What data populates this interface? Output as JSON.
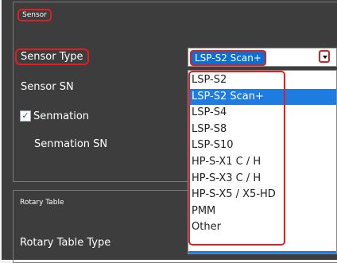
{
  "sensor_group": {
    "title": "Sensor",
    "sensor_type_label": "Sensor Type",
    "sensor_sn_label": "Sensor SN",
    "senmation_label": "Senmation",
    "senmation_checked": true,
    "senmation_sn_label": "Senmation SN"
  },
  "sensor_type_combo": {
    "selected": "LSP-S2 Scan+",
    "options": [
      "LSP-S2",
      "LSP-S2 Scan+",
      "LSP-S4",
      "LSP-S8",
      "LSP-S10",
      "HP-S-X1 C / H",
      "HP-S-X3 C / H",
      "HP-S-X5 / X5-HD",
      "PMM",
      "Other"
    ],
    "highlighted_index": 1
  },
  "rotary_group": {
    "title": "Rotary Table",
    "rotary_table_type_label": "Rotary Table Type"
  },
  "colors": {
    "panel_bg": "#3d3d3d",
    "highlight": "#e02020",
    "selection": "#1e7be0"
  }
}
